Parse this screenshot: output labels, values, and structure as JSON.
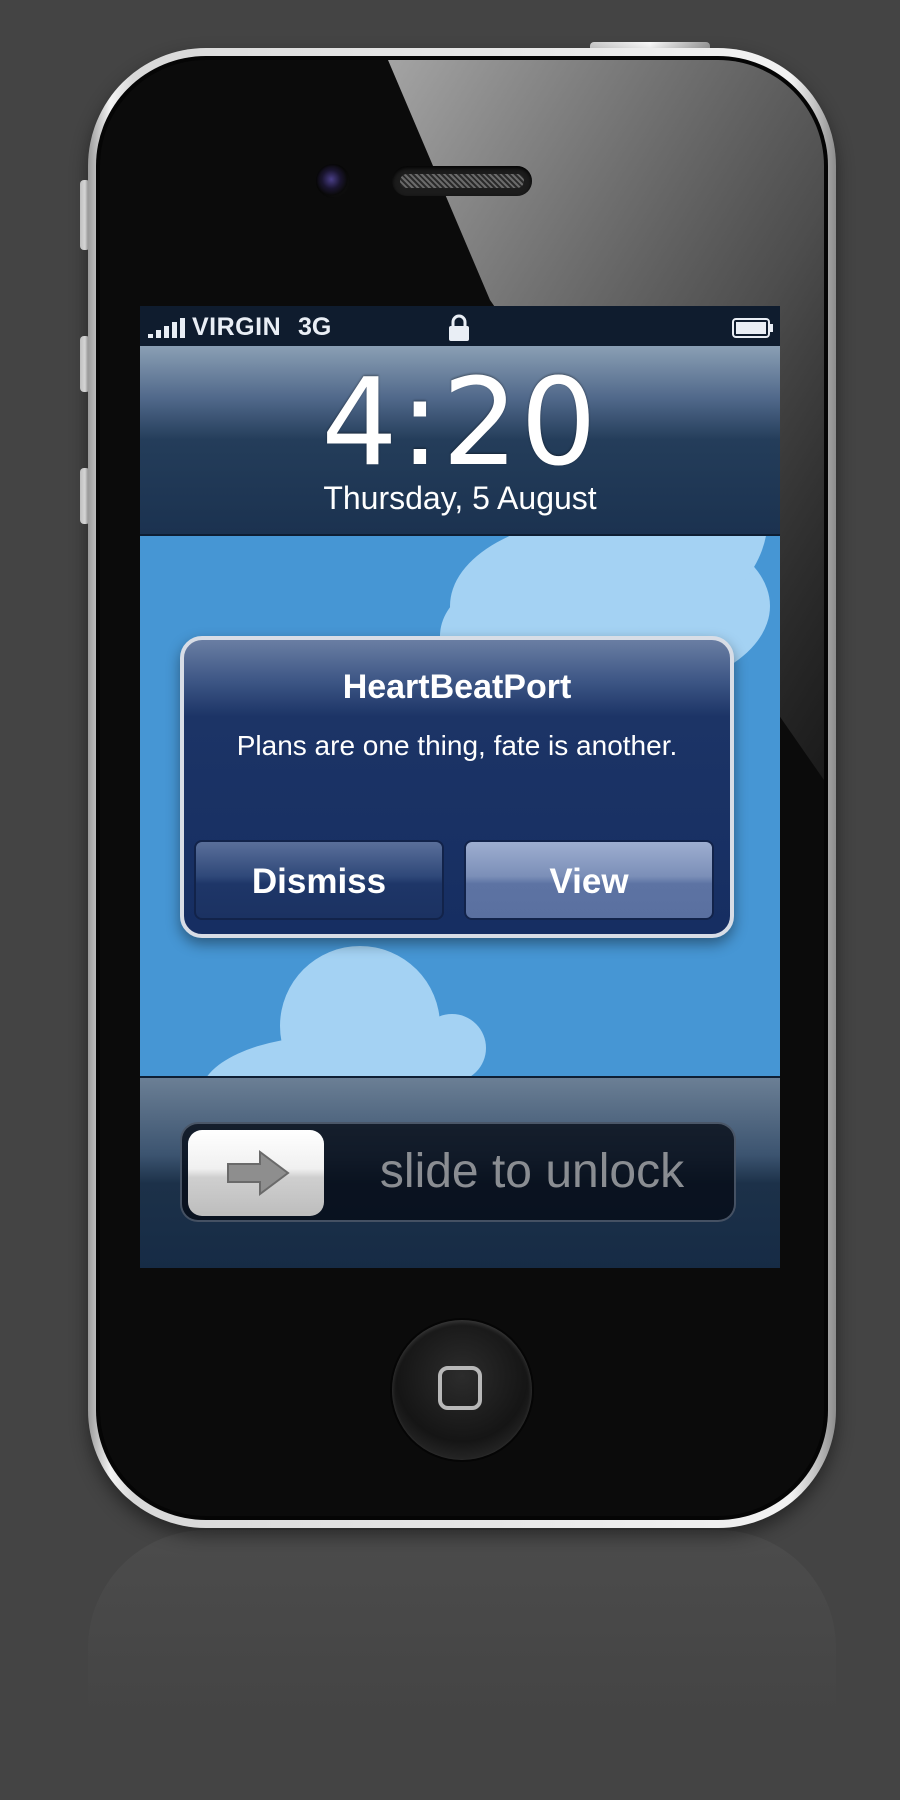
{
  "statusbar": {
    "carrier": "VIRGIN",
    "network": "3G",
    "signal_icon": "signal-bars-icon",
    "lock_icon": "padlock-icon",
    "battery_icon": "battery-icon"
  },
  "lockscreen": {
    "time": "4:20",
    "date": "Thursday, 5 August"
  },
  "alert": {
    "title": "HeartBeatPort",
    "message": "Plans are one thing, fate is another.",
    "dismiss_label": "Dismiss",
    "view_label": "View"
  },
  "unlock": {
    "text_part1": "slide to",
    "text_part2": "unlock",
    "arrow_icon": "arrow-right-icon"
  },
  "device": {
    "home_icon": "home-button-icon"
  },
  "colors": {
    "wallpaper": "#4696d4",
    "alert_bg": "#162e62",
    "background": "#444444"
  }
}
